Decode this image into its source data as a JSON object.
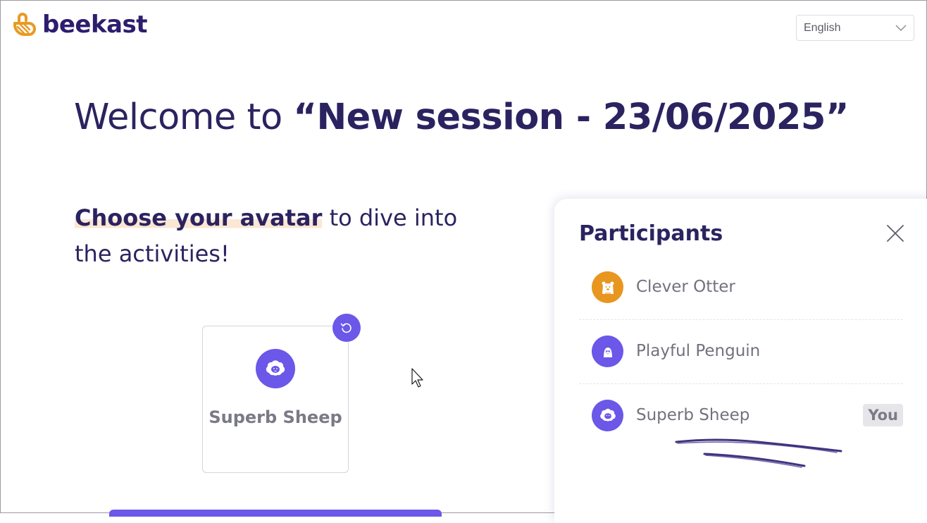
{
  "brand": {
    "name": "beekast",
    "color": "#2c1d6e",
    "accent": "#e89a23"
  },
  "language_select": {
    "selected": "English"
  },
  "welcome": {
    "prefix": "Welcome to ",
    "session_name": "“New session - 23/06/2025”"
  },
  "choose": {
    "highlight": "Choose your avatar",
    "rest": " to dive into the activities!"
  },
  "avatar_card": {
    "name": "Superb Sheep",
    "icon": "sheep-icon",
    "refresh_icon": "refresh-icon"
  },
  "participants": {
    "title": "Participants",
    "close_icon": "close-icon",
    "items": [
      {
        "name": "Clever Otter",
        "icon": "otter-icon",
        "color": "#e8961f",
        "badge": ""
      },
      {
        "name": "Playful Penguin",
        "icon": "penguin-icon",
        "color": "#6b57e8",
        "badge": ""
      },
      {
        "name": "Superb Sheep",
        "icon": "sheep-icon",
        "color": "#6b57e8",
        "badge": "You"
      }
    ]
  },
  "colors": {
    "primary": "#6b57e8",
    "text": "#2b2360",
    "highlight": "#fbe7d3"
  }
}
